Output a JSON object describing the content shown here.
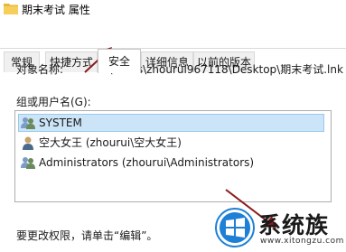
{
  "window": {
    "title": "期末考试 属性"
  },
  "tabs": [
    {
      "label": "常规"
    },
    {
      "label": "快捷方式"
    },
    {
      "label": "安全"
    },
    {
      "label": "详细信息"
    },
    {
      "label": "以前的版本"
    }
  ],
  "active_tab": "安全",
  "object": {
    "label": "对象名称:",
    "value": "C:\\Users\\zhourui967118\\Desktop\\期末考试.lnk"
  },
  "groups": {
    "label": "组或用户名(G):",
    "items": [
      {
        "name": "SYSTEM",
        "icon": "group-icon",
        "selected": true
      },
      {
        "name": "空大女王 (zhourui\\空大女王)",
        "icon": "user-icon",
        "selected": false
      },
      {
        "name": "Administrators (zhourui\\Administrators)",
        "icon": "group-icon",
        "selected": false
      }
    ]
  },
  "hint": "要更改权限，请单击“编辑”。",
  "watermark": {
    "brand": "系统族",
    "url": "www.xitongzu.com"
  },
  "colors": {
    "selection": "#cce4f7",
    "arrow": "#8b1a1a",
    "watermark_blue": "#1e7fd6"
  }
}
